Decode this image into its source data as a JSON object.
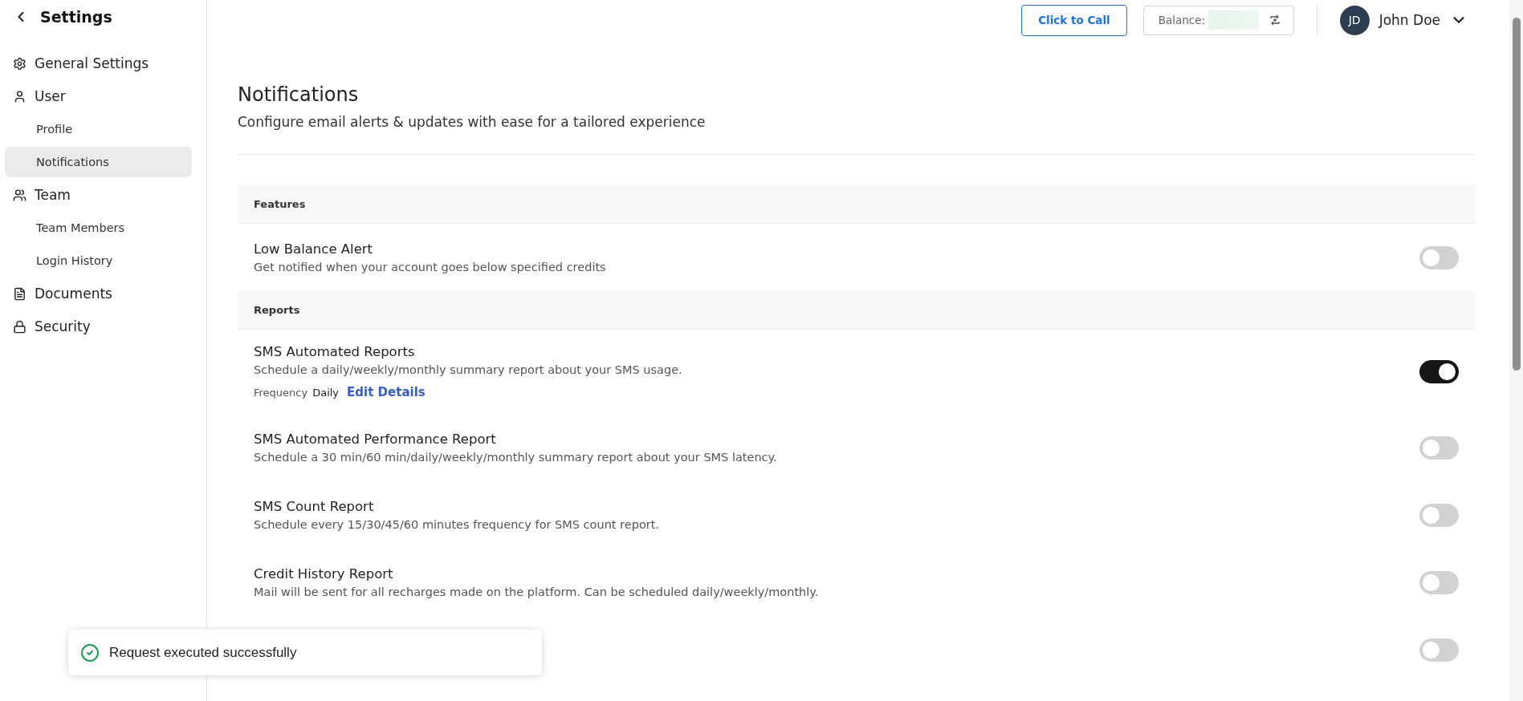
{
  "sidebar": {
    "title": "Settings",
    "items": [
      {
        "label": "General Settings",
        "selected": false
      },
      {
        "label": "User",
        "selected": false,
        "children": [
          {
            "label": "Profile",
            "selected": false
          },
          {
            "label": "Notifications",
            "selected": true
          }
        ]
      },
      {
        "label": "Team",
        "selected": false,
        "children": [
          {
            "label": "Team Members",
            "selected": false
          },
          {
            "label": "Login History",
            "selected": false
          }
        ]
      },
      {
        "label": "Documents",
        "selected": false
      },
      {
        "label": "Security",
        "selected": false
      }
    ]
  },
  "topbar": {
    "call_button": "Click to Call",
    "balance_label": "Balance:",
    "user": {
      "initials": "JD",
      "name": "John Doe"
    }
  },
  "page": {
    "title": "Notifications",
    "subtitle": "Configure email alerts & updates with ease for a tailored experience"
  },
  "sections": [
    {
      "title": "Features",
      "rows": [
        {
          "title": "Low Balance Alert",
          "description": "Get notified when your account goes below specified credits",
          "on": false
        }
      ]
    },
    {
      "title": "Reports",
      "rows": [
        {
          "title": "SMS Automated Reports",
          "description": "Schedule a daily/weekly/monthly summary report about your SMS usage.",
          "on": true,
          "frequency_label": "Frequency",
          "frequency_value": "Daily",
          "edit_link": "Edit Details"
        },
        {
          "title": "SMS Automated Performance Report",
          "description": "Schedule a 30 min/60 min/daily/weekly/monthly summary report about your SMS latency.",
          "on": false
        },
        {
          "title": "SMS Count Report",
          "description": "Schedule every 15/30/45/60 minutes frequency for SMS count report.",
          "on": false
        },
        {
          "title": "Credit History Report",
          "description": "Mail will be sent for all recharges made on the platform. Can be scheduled daily/weekly/monthly.",
          "on": false
        },
        {
          "on": false
        }
      ]
    }
  ],
  "toast": {
    "message": "Request executed successfully"
  }
}
